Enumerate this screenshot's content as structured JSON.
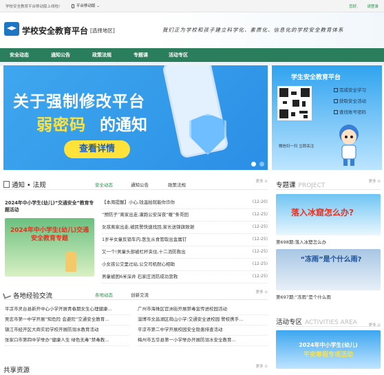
{
  "topbar": {
    "notice": "学校安全教育平台移动版上线啦!",
    "mobile": "平台移动版",
    "greet": "您好,",
    "login": "请登录"
  },
  "header": {
    "site_name": "学校安全教育平台",
    "region": "[选择地区]",
    "slogan": "我们正为学校和孩子建立科学化、素质化、信息化的学校安全教育体系"
  },
  "nav": [
    "安全动态",
    "通知公告",
    "政策法规",
    "专题课",
    "活动专区"
  ],
  "banner": {
    "line1": "关于强制修改平台",
    "line2": "弱密码",
    "line3": "的通知",
    "button": "查看详情"
  },
  "qrpanel": {
    "title": "学生安全教育平台",
    "items": [
      "完成安全学习",
      "获取安全活动",
      "查找账号密码"
    ],
    "caption": "微信扫一扫 立即关注"
  },
  "notice_section": {
    "title": "通知 • 法规",
    "tabs": [
      "安全动态",
      "通知公告",
      "政策法规"
    ],
    "more": "更多",
    "feature_title": "2024年中小学生(幼儿)“交通安全”教育专题活动",
    "feature_banner": "2024年中小学生(幼儿)交通安全教育专题",
    "news": [
      {
        "title": "【本周提醒】小心,钱温拍就能你诈你",
        "date": "(12-20)"
      },
      {
        "title": "“预防子”离家出走,灌跑公安深夜“暖”条哥回",
        "date": "(12-25)"
      },
      {
        "title": "女孩离家出走,被民警快速找回,家长送锦旗致谢",
        "date": "(12-25)"
      },
      {
        "title": "1岁半女童反锁车内,医生从食管取出金属钉",
        "date": "(12-25)"
      },
      {
        "title": "又一个!男童头部被栏杆夹住,十二消防救出",
        "date": "(12-25)"
      },
      {
        "title": "小女孩公交里过站,公交司机耐心相助",
        "date": "(12-25)"
      },
      {
        "title": "男童被困6米深井 石家庄消防成功营救",
        "date": "(12-25)"
      }
    ]
  },
  "exp_section": {
    "title": "各地经验交流",
    "tabs": [
      "各地动态",
      "创新交流"
    ],
    "more": "更多",
    "left": [
      "平凉市灵台县新开中心小学开展青春期女生心理健康...",
      "吴忠市第一中学开展“知危险 会避险”交通安全教育...",
      "镇江市经开区大商实验学校开展防溺水教育活动",
      "张家口市第四中学举办“健康人生 绿色无毒”禁毒教..."
    ],
    "right": [
      "广州市海珠区官洲街开展禁毒宣传进校园活动",
      "淄博市文昌湖区萌山小学:交通安全进校园 警校携手...",
      "平凉市第二中学开展校园安全隐患排查活动",
      "梅州市五华县第一小学举办开展防溺水安全教育..."
    ]
  },
  "share": {
    "title": "共享资源",
    "more": "更多"
  },
  "special": {
    "title": "专题课",
    "en": "PROJECT",
    "more": "更多",
    "cards": [
      {
        "image_text": "落入冰窟怎么办?",
        "caption": "第698期:落入冰窟怎么办"
      },
      {
        "image_text": "“冻雨”是个什么雨?",
        "caption": "第697期:“冻雨”是个什么雨"
      }
    ]
  },
  "activity": {
    "title": "活动专区",
    "en": "ACTIVITIES AREA",
    "more": "更多",
    "card_line1": "2024年中小学生(幼儿)",
    "card_line2": "平安寒假专项活动"
  }
}
